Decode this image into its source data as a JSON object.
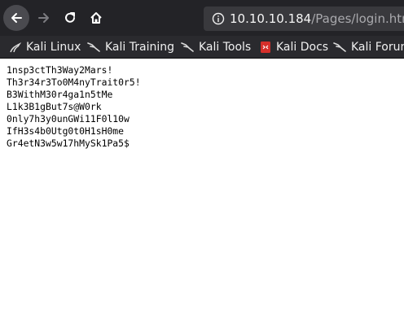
{
  "browser": {
    "url_host": "10.10.10.184",
    "url_path": "/Pages/login.htm"
  },
  "bookmarks": [
    {
      "label": "Kali Linux"
    },
    {
      "label": "Kali Training"
    },
    {
      "label": "Kali Tools"
    },
    {
      "label": "Kali Docs"
    },
    {
      "label": "Kali Forums"
    }
  ],
  "page_lines": [
    "1nsp3ctTh3Way2Mars!",
    "Th3r34r3To0M4nyTrait0r5!",
    "B3WithM30r4ga1n5tMe",
    "L1k3B1gBut7s@W0rk",
    "0nly7h3y0unGWi11F0l10w",
    "IfH3s4b0Utg0t0H1sH0me",
    "Gr4etN3w5w17hMySk1Pa5$"
  ]
}
